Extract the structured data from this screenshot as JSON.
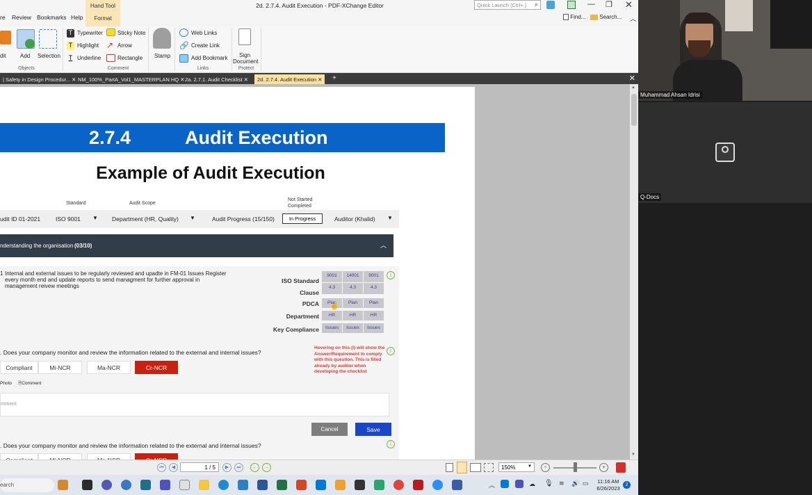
{
  "window": {
    "title": "2d.  2.7.4. Audit Execution - PDF-XChange Editor",
    "quick_launch_placeholder": "Quick Launch (Ctrl+.)",
    "hand_tool": "Hand Tool",
    "format_tab": "Format",
    "find": "Find...",
    "search": "Search..."
  },
  "menu": [
    "re",
    "Review",
    "Bookmarks",
    "Help"
  ],
  "ribbon": {
    "edit": "dit",
    "add": "Add",
    "selection": "Selection",
    "objects": "Objects",
    "typewriter": "Typewriter",
    "highlight": "Highlight",
    "underline": "Underline",
    "sticky_note": "Sticky Note",
    "arrow": "Arrow",
    "rectangle": "Rectangle",
    "comment": "Comment",
    "stamp": "Stamp",
    "web_links": "Web Links",
    "create_link": "Create Link",
    "add_bookmark": "Add Bookmark",
    "links": "Links",
    "sign_document_1": "Sign",
    "sign_document_2": "Document",
    "protect": "Protect"
  },
  "tabs": [
    "| Safety in Design Procedur...",
    "NM_100%_PartA_Vol1_MASTERPLAN HQ",
    "2a.  2.7.1. Audit Checklist",
    "2d.  2.7.4. Audit Execution"
  ],
  "doc": {
    "section_number": "2.7.4",
    "section_title": "Audit Execution",
    "subtitle": "Example of Audit Execution",
    "filter_labels": {
      "standard": "Standard",
      "audit_scope": "Audit Scope",
      "not_started": "Not Started",
      "completed": "Completed"
    },
    "filters": {
      "audit_id": "udit ID 01-2021",
      "standard": "ISO 9001",
      "scope": "Department (HR, Quality)",
      "progress": "Audit Progress (15/150)",
      "status": "In Progress",
      "auditor": "Auditor (Khalid)"
    },
    "section_bar": {
      "label": "nderstanding the organisation",
      "count": "(03/10)"
    },
    "q1": {
      "num": "1",
      "line1": "Internal and external issues to be regularly reviewed and upadte in FM-01 Issues Register",
      "line2": "every month end and update reports to send managment for further approval in",
      "line3": "management reivew meetings"
    },
    "grid": {
      "labels": [
        "ISO Standard",
        "Clause",
        "PDCA",
        "Department",
        "Key Compliance"
      ],
      "rows": [
        [
          "9001",
          "14001",
          "9001"
        ],
        [
          "4.3",
          "4.3",
          "4.3"
        ],
        [
          "Plan",
          "Plan",
          "Plan"
        ],
        [
          "HR",
          "HR",
          "HR"
        ],
        [
          "Issues",
          "Issues",
          "Issues"
        ]
      ]
    },
    "question": ". Does your company monitor and review the information related to the external and internal issues?",
    "options": [
      "Compliant",
      "Mi-NCR",
      "Ma-NCR",
      "Cr-NCR"
    ],
    "photo": "Photo",
    "comment": "Comment",
    "comment_placeholder": "mment",
    "note": "Hovering on this (i) will show the Answer/Requirement to comply with this question. This is filled already by auditor when developing the checklist",
    "cancel": "Cancel",
    "save": "Save",
    "question2": ". Does your company monitor and review the information related to the external and internal issues?",
    "options2": [
      "Compliant",
      "Mi-NCR",
      "Ma-NCR",
      "Cr-NCR"
    ]
  },
  "status": {
    "page": "1 / 5",
    "zoom": "150%"
  },
  "taskbar": {
    "search": "earch",
    "time": "11:16 AM",
    "date": "6/26/2023",
    "badge": "2"
  },
  "participants": {
    "p1": "Muhammad Ahsan Idrisi",
    "p2": "Q-Docs"
  },
  "colors": {
    "accent_blue": "#0a64c8",
    "cr_ncr": "#c8210f",
    "save": "#1a46c8",
    "note_red": "#e53935",
    "handtool_bg": "#fbe5b6"
  }
}
